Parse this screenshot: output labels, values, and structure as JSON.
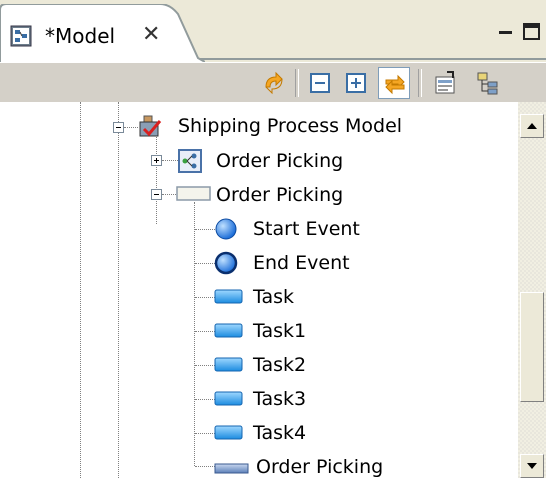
{
  "tab": {
    "title": "*Model",
    "icon": "model-editor-icon",
    "close_icon": "close-icon"
  },
  "window_controls": [
    "minimize-icon",
    "maximize-icon"
  ],
  "toolbar": {
    "buttons": [
      {
        "name": "sync-icon"
      },
      {
        "name": "collapse-all-icon"
      },
      {
        "name": "expand-all-icon"
      },
      {
        "name": "link-with-editor-icon",
        "pressed": true
      },
      {
        "name": "properties-icon"
      },
      {
        "name": "hierarchy-icon"
      }
    ]
  },
  "tree": {
    "root": {
      "label": "Shipping Process Model",
      "icon": "process-model-icon",
      "expanded": true
    },
    "children": [
      {
        "label": "Order Picking",
        "icon": "diagram-icon",
        "expanded": false
      },
      {
        "label": "Order Picking",
        "icon": "pool-icon",
        "expanded": true,
        "children": [
          {
            "label": "Start Event",
            "icon": "start-event-icon"
          },
          {
            "label": "End Event",
            "icon": "end-event-icon"
          },
          {
            "label": "Task",
            "icon": "task-icon"
          },
          {
            "label": "Task1",
            "icon": "task-icon"
          },
          {
            "label": "Task2",
            "icon": "task-icon"
          },
          {
            "label": "Task3",
            "icon": "task-icon"
          },
          {
            "label": "Task4",
            "icon": "task-icon"
          },
          {
            "label": "Order Picking",
            "icon": "lane-icon"
          }
        ]
      }
    ]
  },
  "colors": {
    "accent_orange": "#f5a623",
    "event_blue": "#1e6fd9",
    "task_blue": "#3fa8f0"
  }
}
